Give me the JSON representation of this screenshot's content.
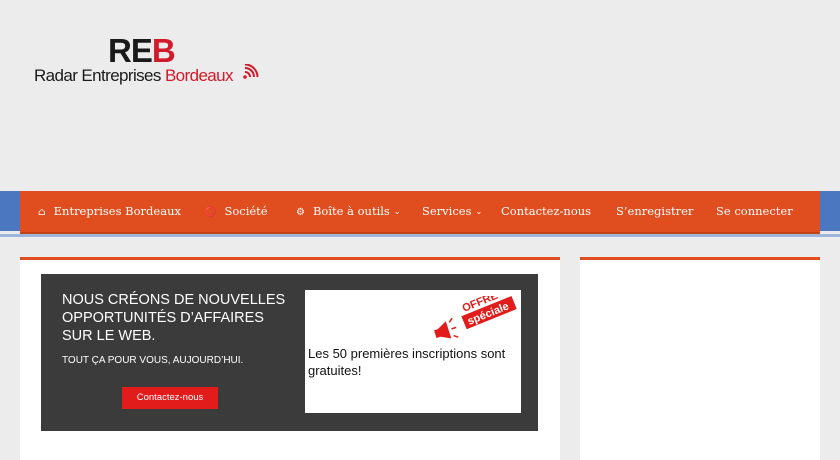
{
  "logo": {
    "mark_re": "RE",
    "mark_b": "B",
    "name_main": "Radar Entreprises ",
    "name_accent": "Bordeaux"
  },
  "colors": {
    "accent": "#e04e1f",
    "brand_red": "#d11a2a",
    "nav_side": "#4a77c0",
    "banner_bg": "#3b3b3b",
    "button_red": "#e21b1b"
  },
  "nav": {
    "items": [
      {
        "label": "Entreprises Bordeaux",
        "icon": "home-icon"
      },
      {
        "label": "Société",
        "icon": "rss-icon"
      },
      {
        "label": "Boîte à outils",
        "icon": "gear-icon",
        "has_dropdown": true
      },
      {
        "label": "Services",
        "has_dropdown": true
      },
      {
        "label": "Contactez-nous"
      },
      {
        "label": "S’enregistrer"
      },
      {
        "label": "Se connecter"
      }
    ]
  },
  "banner": {
    "title": "NOUS CRÉONS DE NOUVELLES OPPORTUNITÉS D’AFFAIRES SUR LE WEB.",
    "subtitle": "TOUT ÇA POUR VOUS, AUJOURD’HUI.",
    "button_label": "Contactez-nous",
    "offer_badge_line1": "OFFRE",
    "offer_badge_line2": "spéciale",
    "offer_text": "Les 50 premières inscriptions sont gratuites!"
  }
}
